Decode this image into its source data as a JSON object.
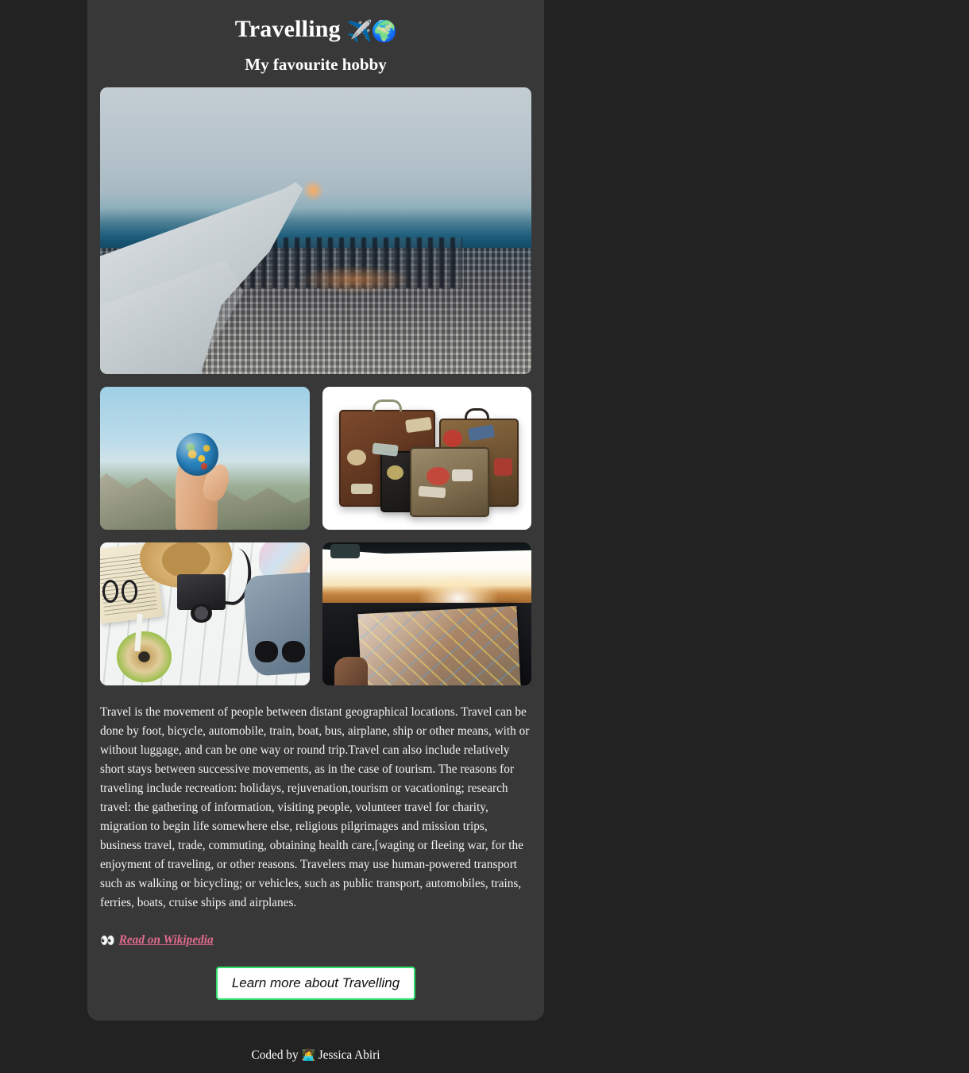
{
  "page": {
    "background_color": "#222222",
    "card_color": "#383838"
  },
  "header": {
    "title": "Travelling",
    "title_emoji": "✈️🌍",
    "subtitle": "My favourite hobby"
  },
  "hero": {
    "alt": "Airplane wing over a snow-covered city seen from a window seat"
  },
  "gallery": [
    {
      "name": "globe-in-hand",
      "alt": "Hand holding a small globe in front of mountains"
    },
    {
      "name": "vintage-suitcases",
      "alt": "Three vintage suitcases covered in travel stickers"
    },
    {
      "name": "travel-flatlay",
      "alt": "Flat lay of book, glasses, straw hat, camera, coconut drink and denim"
    },
    {
      "name": "road-trip-map",
      "alt": "Road map on a car dashboard at sunset"
    }
  ],
  "article": {
    "paragraph": "Travel is the movement of people between distant geographical locations. Travel can be done by foot, bicycle, automobile, train, boat, bus, airplane, ship or other means, with or without luggage, and can be one way or round trip.Travel can also include relatively short stays between successive movements, as in the case of tourism. The reasons for traveling include recreation: holidays, rejuvenation,tourism or vacationing; research travel: the gathering of information, visiting people, volunteer travel for charity, migration to begin life somewhere else, religious pilgrimages and mission trips, business travel, trade, commuting, obtaining health care,[waging or fleeing war, for the enjoyment of traveling, or other reasons. Travelers may use human-powered transport such as walking or bicycling; or vehicles, such as public transport, automobiles, trains, ferries, boats, cruise ships and airplanes."
  },
  "wikipedia": {
    "eyes_emoji": "👀",
    "link_label": "Read on Wikipedia",
    "link_color": "#e26a8d"
  },
  "cta": {
    "button_label": "Learn more about Travelling",
    "border_color": "#2ee06a",
    "background_color": "#ffffff"
  },
  "footer": {
    "prefix": "Coded by",
    "emoji": "👩‍💻",
    "author": "Jessica Abiri"
  }
}
